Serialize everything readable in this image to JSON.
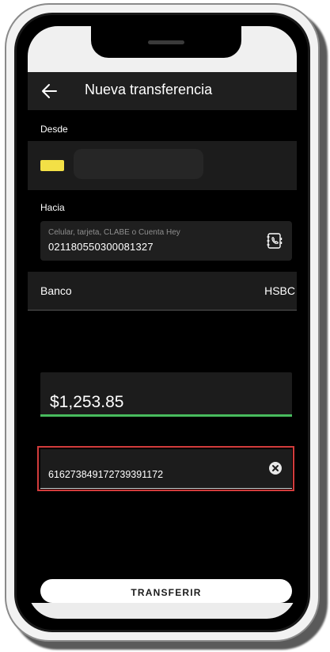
{
  "header": {
    "title": "Nueva transferencia",
    "back_icon": "arrow-left-icon"
  },
  "from": {
    "label": "Desde",
    "card_color": "#f3e046",
    "account_text": ""
  },
  "to": {
    "label": "Hacia",
    "placeholder": "Celular, tarjeta, CLABE o Cuenta Hey",
    "value": "021180550300081327",
    "contacts_icon": "contacts-book-icon"
  },
  "bank": {
    "label": "Banco",
    "value": "HSBC"
  },
  "amount": {
    "value": "$1,253.85",
    "underline_color": "#48bb5e"
  },
  "reference": {
    "value": "616273849172739391172",
    "clear_icon": "clear-circle-icon",
    "highlight_color": "#d23c3c"
  },
  "actions": {
    "transfer_label": "TRANSFERIR"
  }
}
